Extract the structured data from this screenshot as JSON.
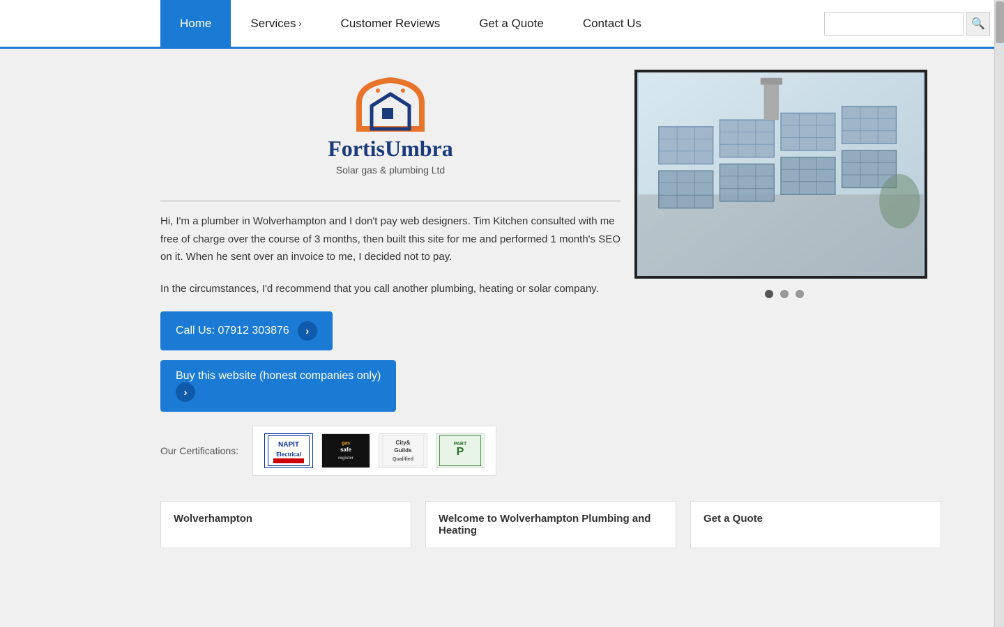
{
  "nav": {
    "items": [
      {
        "label": "Home",
        "active": true
      },
      {
        "label": "Services",
        "has_arrow": true
      },
      {
        "label": "Customer Reviews"
      },
      {
        "label": "Get a Quote"
      },
      {
        "label": "Contact Us"
      }
    ],
    "search_placeholder": ""
  },
  "logo": {
    "text_main": "FortisUmbra",
    "text_sub": "Solar gas & plumbing Ltd"
  },
  "body": {
    "paragraph1": "Hi, I'm a plumber in Wolverhampton and I don't pay web designers. Tim Kitchen consulted with me free of charge over the course of 3 months, then built this site for me and performed 1 month's SEO on it. When he sent over an invoice to me, I decided not to pay.",
    "paragraph2": "In the circumstances, I'd recommend that you call another plumbing, heating or solar company."
  },
  "buttons": {
    "call_us": "Call Us: 07912 303876",
    "buy_website": "Buy this website (honest companies only)"
  },
  "certifications": {
    "label": "Our Certifications:",
    "logos": [
      {
        "name": "NAPIT Electrical",
        "short": "NAPIT\nElectrical"
      },
      {
        "name": "Gas Safe Register",
        "short": "gas\nsafe\nregister"
      },
      {
        "name": "City & Guilds Qualified",
        "short": "City&\nGuilds\nQualified"
      },
      {
        "name": "Part P",
        "short": "PART P"
      }
    ]
  },
  "bottom_cards": [
    {
      "label": "Wolverhampton"
    },
    {
      "label": "Welcome to Wolverhampton Plumbing and Heating"
    },
    {
      "label": "Get a Quote"
    }
  ],
  "slider": {
    "dots": 3,
    "active_dot": 0
  }
}
